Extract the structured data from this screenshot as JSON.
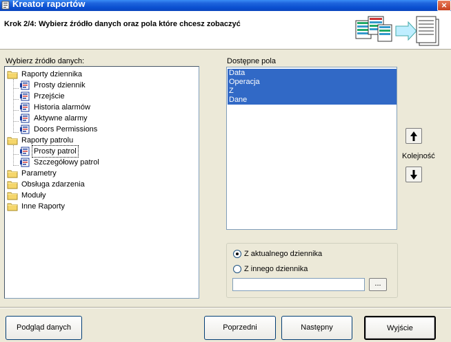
{
  "window": {
    "title": "Kreator raportów",
    "close_label": "×"
  },
  "header": {
    "step_text": "Krok 2/4: Wybierz źródło danych oraz pola które chcesz zobaczyć"
  },
  "source": {
    "label": "Wybierz źródło danych:",
    "tree": [
      {
        "label": "Raporty dziennika",
        "type": "folder"
      },
      {
        "label": "Prosty dziennik",
        "type": "report"
      },
      {
        "label": "Przejście",
        "type": "report"
      },
      {
        "label": "Historia alarmów",
        "type": "report"
      },
      {
        "label": "Aktywne alarmy",
        "type": "report"
      },
      {
        "label": "Doors Permissions",
        "type": "report"
      },
      {
        "label": "Raporty patrolu",
        "type": "folder"
      },
      {
        "label": "Prosty patrol",
        "type": "report",
        "selected": true
      },
      {
        "label": "Szczegółowy patrol",
        "type": "report"
      },
      {
        "label": "Parametry",
        "type": "folder"
      },
      {
        "label": "Obsługa zdarzenia",
        "type": "folder"
      },
      {
        "label": "Moduły",
        "type": "folder"
      },
      {
        "label": "Inne Raporty",
        "type": "folder"
      }
    ]
  },
  "fields": {
    "label": "Dostępne pola",
    "items": [
      "Data",
      "Operacja",
      "Z",
      "Dane"
    ],
    "order_label": "Kolejność",
    "up_icon": "arrow-up-icon",
    "down_icon": "arrow-down-icon"
  },
  "log_source": {
    "option_current": "Z aktualnego dziennika",
    "option_other": "Z innego dziennika",
    "selected": "current",
    "path_value": "",
    "browse_label": "..."
  },
  "buttons": {
    "preview": "Podgląd danych",
    "back": "Poprzedni",
    "next": "Następny",
    "exit": "Wyjście"
  },
  "colors": {
    "titlebar": "#0a4fd0",
    "selection": "#3169c6",
    "face": "#ece9d8"
  }
}
